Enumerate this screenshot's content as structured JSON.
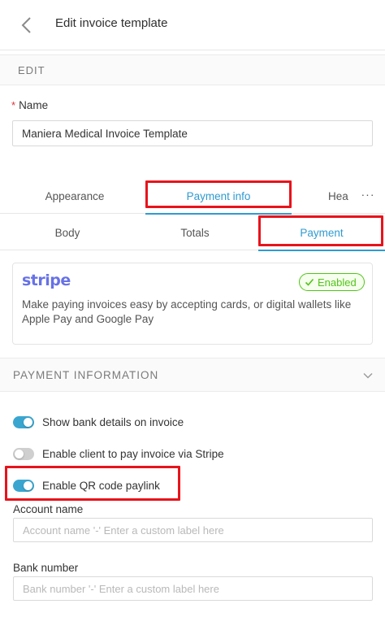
{
  "header": {
    "title": "Edit invoice template"
  },
  "section_edit": {
    "label": "EDIT"
  },
  "name_field": {
    "required_mark": "*",
    "label": "Name",
    "value": "Maniera Medical Invoice Template"
  },
  "tabs_primary": {
    "items": [
      {
        "label": "Appearance",
        "active": false
      },
      {
        "label": "Payment info",
        "active": true
      },
      {
        "label": "Hea",
        "active": false
      }
    ],
    "more": "···"
  },
  "tabs_secondary": {
    "items": [
      {
        "label": "Body",
        "active": false
      },
      {
        "label": "Totals",
        "active": false
      },
      {
        "label": "Payment",
        "active": true
      }
    ]
  },
  "stripe": {
    "logo": "stripe",
    "badge": "Enabled",
    "description": "Make paying invoices easy by accepting cards, or digital wallets like Apple Pay and Google Pay"
  },
  "payment_info": {
    "title": "PAYMENT INFORMATION",
    "toggles": [
      {
        "label": "Show bank details on invoice",
        "on": true
      },
      {
        "label": "Enable client to pay invoice via Stripe",
        "on": false
      },
      {
        "label": "Enable QR code paylink",
        "on": true
      }
    ],
    "account_name": {
      "label": "Account name",
      "placeholder": "Account name '-' Enter a custom label here"
    },
    "bank_number": {
      "label": "Bank number",
      "placeholder": "Bank number '-' Enter a custom label here"
    }
  },
  "colors": {
    "accent": "#2f9bd0",
    "toggle_on": "#3aa6d0",
    "highlight": "#e8131b",
    "enabled": "#52c41a",
    "stripe_brand": "#6772e5"
  },
  "icons": {
    "back": "chevron-left-icon",
    "collapse": "chevron-down-icon",
    "badge": "check-icon"
  }
}
